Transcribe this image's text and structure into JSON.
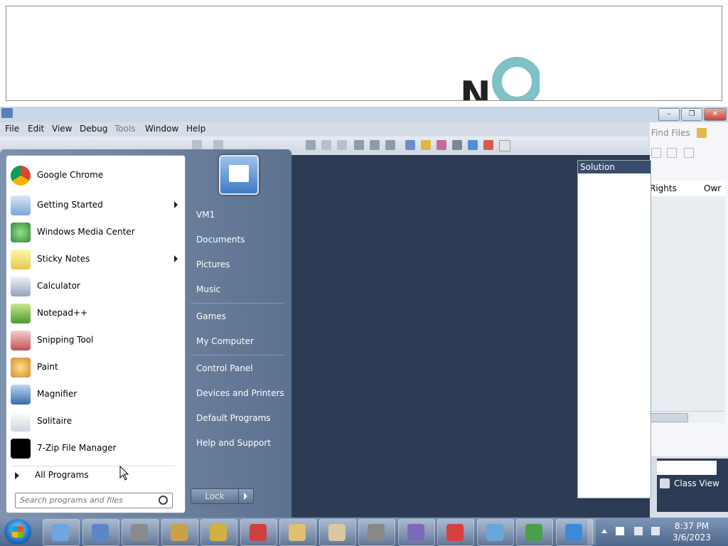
{
  "colors": {
    "accent": "#2d3b55",
    "start_menu": "#5c7290",
    "taskbar": "#4f678a"
  },
  "ide": {
    "menu": [
      "File",
      "Edit",
      "View",
      "Debug",
      "Tools",
      "Window",
      "Help"
    ],
    "solution_explorer_title": "Solution Explorer",
    "find_files_label": "Find Files",
    "columns": [
      "Rights",
      "Owr"
    ],
    "class_view_label": "Class View"
  },
  "start_menu": {
    "programs": [
      {
        "label": "Google Chrome",
        "icon": "chrome-icon",
        "submenu": false
      },
      {
        "label": "Getting Started",
        "icon": "getting-started-icon",
        "submenu": true
      },
      {
        "label": "Windows Media Center",
        "icon": "media-center-icon",
        "submenu": false
      },
      {
        "label": "Sticky Notes",
        "icon": "sticky-notes-icon",
        "submenu": true
      },
      {
        "label": "Calculator",
        "icon": "calculator-icon",
        "submenu": false
      },
      {
        "label": "Notepad++",
        "icon": "notepadpp-icon",
        "submenu": false
      },
      {
        "label": "Snipping Tool",
        "icon": "snipping-tool-icon",
        "submenu": false
      },
      {
        "label": "Paint",
        "icon": "paint-icon",
        "submenu": false
      },
      {
        "label": "Magnifier",
        "icon": "magnifier-icon",
        "submenu": false
      },
      {
        "label": "Solitaire",
        "icon": "solitaire-icon",
        "submenu": false
      },
      {
        "label": "7-Zip File Manager",
        "icon": "seven-zip-icon",
        "submenu": false
      }
    ],
    "all_programs": "All Programs",
    "search_placeholder": "Search programs and files",
    "right_links": [
      "VM1",
      "Documents",
      "Pictures",
      "Music",
      "Games",
      "My Computer",
      "Control Panel",
      "Devices and Printers",
      "Default Programs",
      "Help and Support"
    ],
    "lock_label": "Lock"
  },
  "taskbar": {
    "time": "8:37 PM",
    "date": "3/6/2023",
    "apps": [
      "media-player-icon",
      "remote-desktop-icon",
      "chess-icon",
      "hearts-king-icon",
      "mahjong-icon",
      "purble-icon",
      "spades-icon",
      "mahjong-tiles-icon",
      "settings-gear-icon",
      "spider-solitaire-icon",
      "hearts-icon",
      "paper-plane-icon",
      "windows-icon",
      "internet-explorer-icon"
    ]
  }
}
